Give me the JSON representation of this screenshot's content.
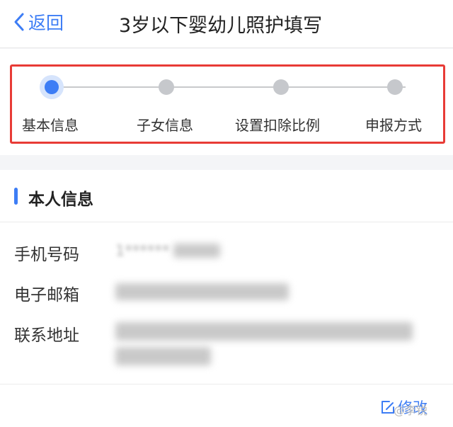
{
  "header": {
    "back_label": "返回",
    "title": "3岁以下婴幼儿照护填写"
  },
  "steps": [
    {
      "label": "基本信息",
      "active": true
    },
    {
      "label": "子女信息",
      "active": false
    },
    {
      "label": "设置扣除比例",
      "active": false
    },
    {
      "label": "申报方式",
      "active": false
    }
  ],
  "section": {
    "title": "本人信息",
    "phone_label": "手机号码",
    "phone_value": "1******",
    "email_label": "电子邮箱",
    "address_label": "联系地址",
    "edit_label": "修改"
  },
  "watermark": "@李锐",
  "colors": {
    "accent": "#3d7df5",
    "highlight_border": "#e83b36"
  }
}
